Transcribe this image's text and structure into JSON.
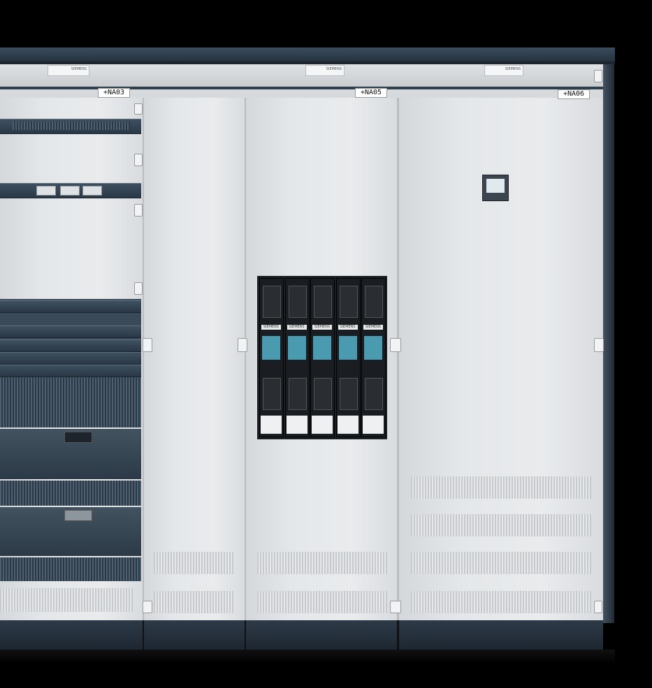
{
  "cabinets": {
    "labels": [
      "+NA03",
      "+NA05",
      "+NA06"
    ],
    "logos": [
      "SIEMENS",
      "SIEMENS",
      "SIEMENS"
    ]
  },
  "fuse_panel": {
    "switch_count": 5,
    "brand_label": "SIEMENS"
  },
  "colors": {
    "cabinet": "#e4e7e9",
    "frame": "#2e3e4c",
    "accent": "#4a9bb0",
    "background": "#000000"
  }
}
